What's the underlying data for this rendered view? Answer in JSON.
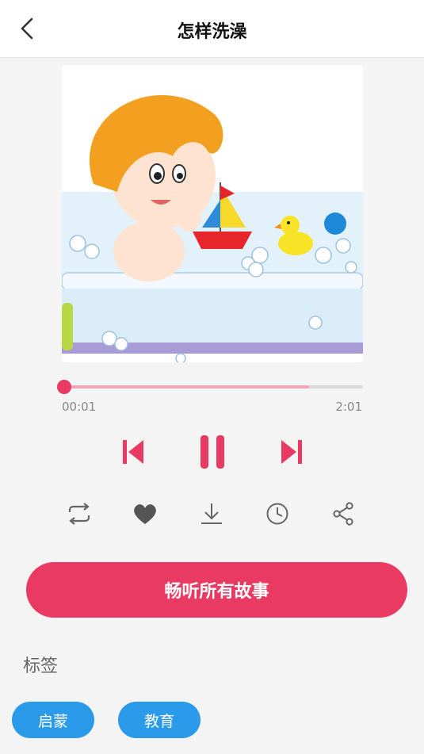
{
  "header": {
    "title": "怎样洗澡",
    "back_icon": "chevron-left-icon"
  },
  "player": {
    "current_time": "00:01",
    "total_time": "2:01",
    "progress_fraction": 0.008,
    "buffered_fraction": 0.82,
    "controls": [
      "skip-previous-icon",
      "pause-icon",
      "skip-next-icon"
    ],
    "actions": [
      "repeat-icon",
      "heart-icon",
      "download-icon",
      "clock-icon",
      "share-icon"
    ]
  },
  "cta": {
    "label": "畅听所有故事"
  },
  "tags_section": {
    "label": "标签",
    "tags": [
      "启蒙",
      "教育"
    ]
  },
  "colors": {
    "accent": "#e83a62",
    "tag": "#2b9ae8",
    "background": "#f4f4f4"
  }
}
